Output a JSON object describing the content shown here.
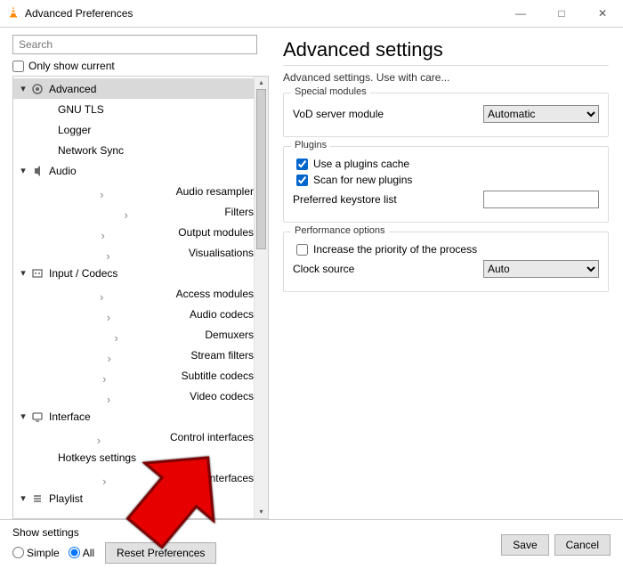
{
  "window": {
    "title": "Advanced Preferences",
    "min": "—",
    "max": "□",
    "close": "✕"
  },
  "left": {
    "search_placeholder": "Search",
    "only_show_current": "Only show current",
    "tree": {
      "advanced": "Advanced",
      "gnu_tls": "GNU TLS",
      "logger": "Logger",
      "network_sync": "Network Sync",
      "audio": "Audio",
      "audio_resampler": "Audio resampler",
      "filters": "Filters",
      "output_modules": "Output modules",
      "visualisations": "Visualisations",
      "input_codecs": "Input / Codecs",
      "access_modules": "Access modules",
      "audio_codecs": "Audio codecs",
      "demuxers": "Demuxers",
      "stream_filters": "Stream filters",
      "subtitle_codecs": "Subtitle codecs",
      "video_codecs": "Video codecs",
      "interface": "Interface",
      "control_interfaces": "Control interfaces",
      "hotkeys_settings": "Hotkeys settings",
      "main_interfaces": "Main interfaces",
      "playlist": "Playlist"
    }
  },
  "right": {
    "heading": "Advanced settings",
    "subhead": "Advanced settings. Use with care...",
    "special_modules": {
      "legend": "Special modules",
      "vod_label": "VoD server module",
      "vod_value": "Automatic"
    },
    "plugins": {
      "legend": "Plugins",
      "use_cache": "Use a plugins cache",
      "scan_new": "Scan for new plugins",
      "keystore_label": "Preferred keystore list",
      "keystore_value": ""
    },
    "perf": {
      "legend": "Performance options",
      "priority": "Increase the priority of the process",
      "clock_label": "Clock source",
      "clock_value": "Auto"
    }
  },
  "footer": {
    "show": "Show settings",
    "simple": "Simple",
    "all": "All",
    "reset": "Reset Preferences",
    "save": "Save",
    "cancel": "Cancel"
  }
}
